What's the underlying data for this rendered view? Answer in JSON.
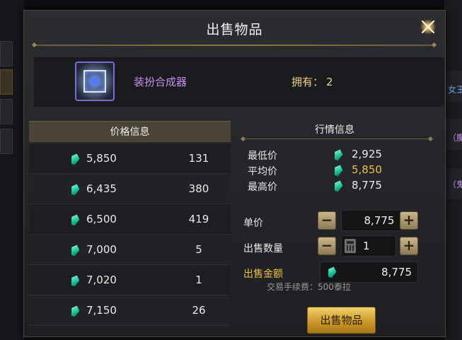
{
  "dialog": {
    "title": "出售物品",
    "item": {
      "name": "装扮合成器",
      "owned_label": "拥有：",
      "owned_count": "2"
    }
  },
  "price_panel": {
    "header": "价格信息",
    "rows": [
      {
        "price": "5,850",
        "count": "131"
      },
      {
        "price": "6,435",
        "count": "380"
      },
      {
        "price": "6,500",
        "count": "419"
      },
      {
        "price": "7,000",
        "count": "5"
      },
      {
        "price": "7,020",
        "count": "1"
      },
      {
        "price": "7,150",
        "count": "26"
      }
    ]
  },
  "market": {
    "title": "行情信息",
    "min_label": "最低价",
    "min_value": "2,925",
    "avg_label": "平均价",
    "avg_value": "5,850",
    "max_label": "最高价",
    "max_value": "8,775"
  },
  "controls": {
    "unit_price_label": "单价",
    "unit_price_value": "8,775",
    "quantity_label": "出售数量",
    "quantity_value": "1",
    "total_label": "出售金额",
    "total_value": "8,775",
    "minus": "−",
    "plus": "+"
  },
  "fee_text": "交易手续费：500泰拉",
  "sell_button": "出售物品",
  "background": {
    "right_text_1": "女王",
    "right_text_2": "（魔",
    "right_text_3": "（鬼"
  },
  "colors": {
    "accent_gold": "#f0c043",
    "item_name_purple": "#c88df0",
    "gem_green": "#19c69a"
  },
  "icons": [
    "close-icon",
    "item-icon",
    "gem-icon",
    "calculator-icon"
  ]
}
